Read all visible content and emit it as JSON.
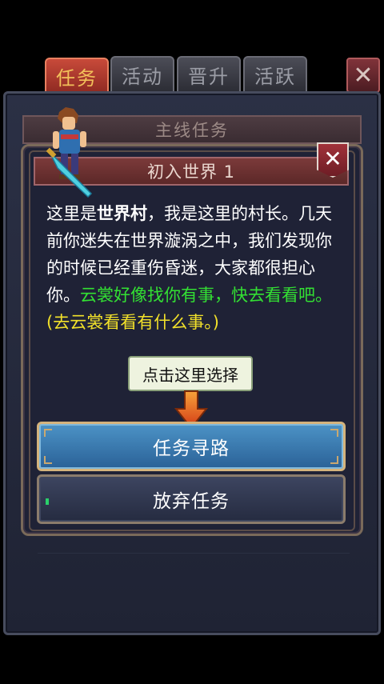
{
  "tabs": [
    {
      "label": "任务",
      "active": true
    },
    {
      "label": "活动",
      "active": false
    },
    {
      "label": "晋升",
      "active": false
    },
    {
      "label": "活跃",
      "active": false
    }
  ],
  "top_close_symbol": "✕",
  "quest_header": "主线任务",
  "dialog": {
    "title": "初入世界 1",
    "close_symbol": "✕",
    "text": {
      "p1": "这里是",
      "p1_bold": "世界村",
      "p1_rest": "，我是这里的村长。几天前你迷失在世界漩涡之中，我们发现你的时候已经重伤昏迷，大家都很担心你。",
      "p2_green": "云裳好像找你有事，快去看看吧。",
      "p3_yellow": "(去云裳看看有什么事。)"
    }
  },
  "tooltip": "点击这里选择",
  "buttons": {
    "primary": "任务寻路",
    "secondary": "放弃任务"
  },
  "colors": {
    "accent_gold": "#f2c15a",
    "green_text": "#33e033",
    "yellow_text": "#f2e12a",
    "primary_button": "#3a7ab0"
  },
  "icons": {
    "close": "close-icon",
    "hint_arrow": "down-arrow-icon",
    "character": "hero-sprite"
  }
}
